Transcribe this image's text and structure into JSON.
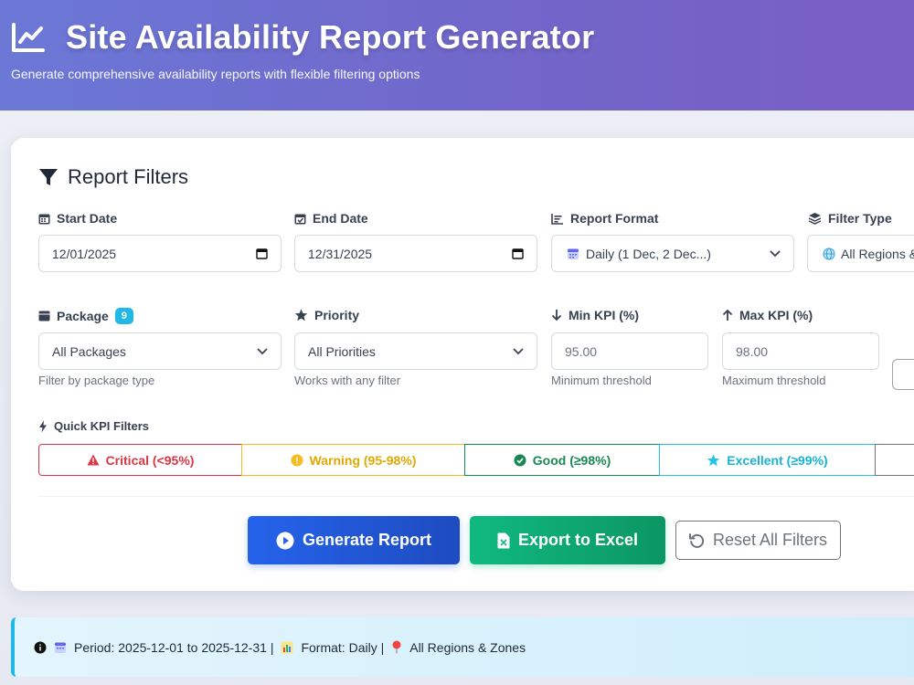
{
  "header": {
    "title": "Site Availability Report Generator",
    "subtitle": "Generate comprehensive availability reports with flexible filtering options",
    "icon": "chart-line-icon"
  },
  "filters": {
    "title": "Report Filters",
    "start_date": {
      "label": "Start Date",
      "value": "12/01/2025"
    },
    "end_date": {
      "label": "End Date",
      "value": "12/31/2025"
    },
    "report_format": {
      "label": "Report Format",
      "value": "Daily (1 Dec, 2 Dec...)"
    },
    "filter_type": {
      "label": "Filter Type",
      "value": "All Regions &"
    },
    "package": {
      "label": "Package",
      "badge": "9",
      "value": "All Packages",
      "help": "Filter by package type"
    },
    "priority": {
      "label": "Priority",
      "value": "All Priorities",
      "help": "Works with any filter"
    },
    "min_kpi": {
      "label": "Min KPI (%)",
      "placeholder": "95.00",
      "help": "Minimum threshold"
    },
    "max_kpi": {
      "label": "Max KPI (%)",
      "placeholder": "98.00",
      "help": "Maximum threshold"
    }
  },
  "quick_filters": {
    "label": "Quick KPI Filters",
    "critical": "Critical (<95%)",
    "warning": "Warning (95-98%)",
    "good": "Good (≥98%)",
    "excellent": "Excellent (≥99%)"
  },
  "actions": {
    "generate": "Generate Report",
    "export": "Export to Excel",
    "reset": "Reset All Filters"
  },
  "info_bar": {
    "period": "Period: 2025-12-01 to 2025-12-31 |",
    "format": "Format: Daily |",
    "scope": "All Regions & Zones"
  },
  "colors": {
    "header_start": "#6b78d6",
    "header_end": "#7a5fc4",
    "primary": "#2563eb",
    "success": "#10b981",
    "danger": "#dc3545",
    "warning": "#f4bd1f",
    "info": "#22b8e6"
  }
}
